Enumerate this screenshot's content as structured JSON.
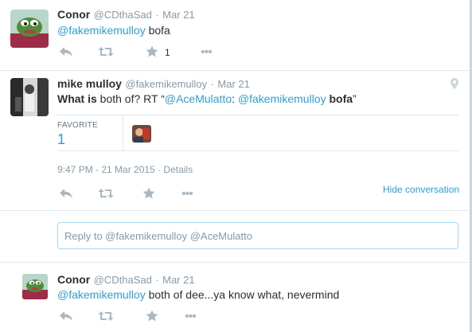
{
  "tweet1": {
    "name": "Conor",
    "handle": "@CDthaSad",
    "sep": "·",
    "date": "Mar 21",
    "mention": "@fakemikemulloy",
    "text": " bofa",
    "fav_count": "1",
    "avatar_icon": "frog-avatar"
  },
  "tweet2": {
    "name": "mike mulloy",
    "handle": "@fakemikemulloy",
    "sep": "·",
    "date": "Mar 21",
    "text_bold1": "What is",
    "text_plain1": " both of? RT “",
    "mention1": "@AceMulatto",
    "text_plain2": ": ",
    "mention2": "@fakemikemulloy",
    "text_bold2": " bofa",
    "text_end": "”",
    "favorite_label": "FAVORITE",
    "favorite_count": "1",
    "timestamp": "9:47 PM - 21 Mar 2015",
    "details_sep": "·",
    "details": "Details",
    "hide_conversation": "Hide conversation",
    "avatar_icon": "photo-avatar"
  },
  "reply_box": {
    "placeholder": "Reply to @fakemikemulloy @AceMulatto"
  },
  "tweet3": {
    "name": "Conor",
    "handle": "@CDthaSad",
    "sep": "·",
    "date": "Mar 21",
    "mention": "@fakemikemulloy",
    "text": " both of dee...ya know what, nevermind",
    "avatar_icon": "frog-avatar"
  },
  "colors": {
    "link": "#2a9fd6",
    "muted": "#8899a6",
    "icon": "#aab8c2",
    "divider": "#e1e8ed"
  }
}
